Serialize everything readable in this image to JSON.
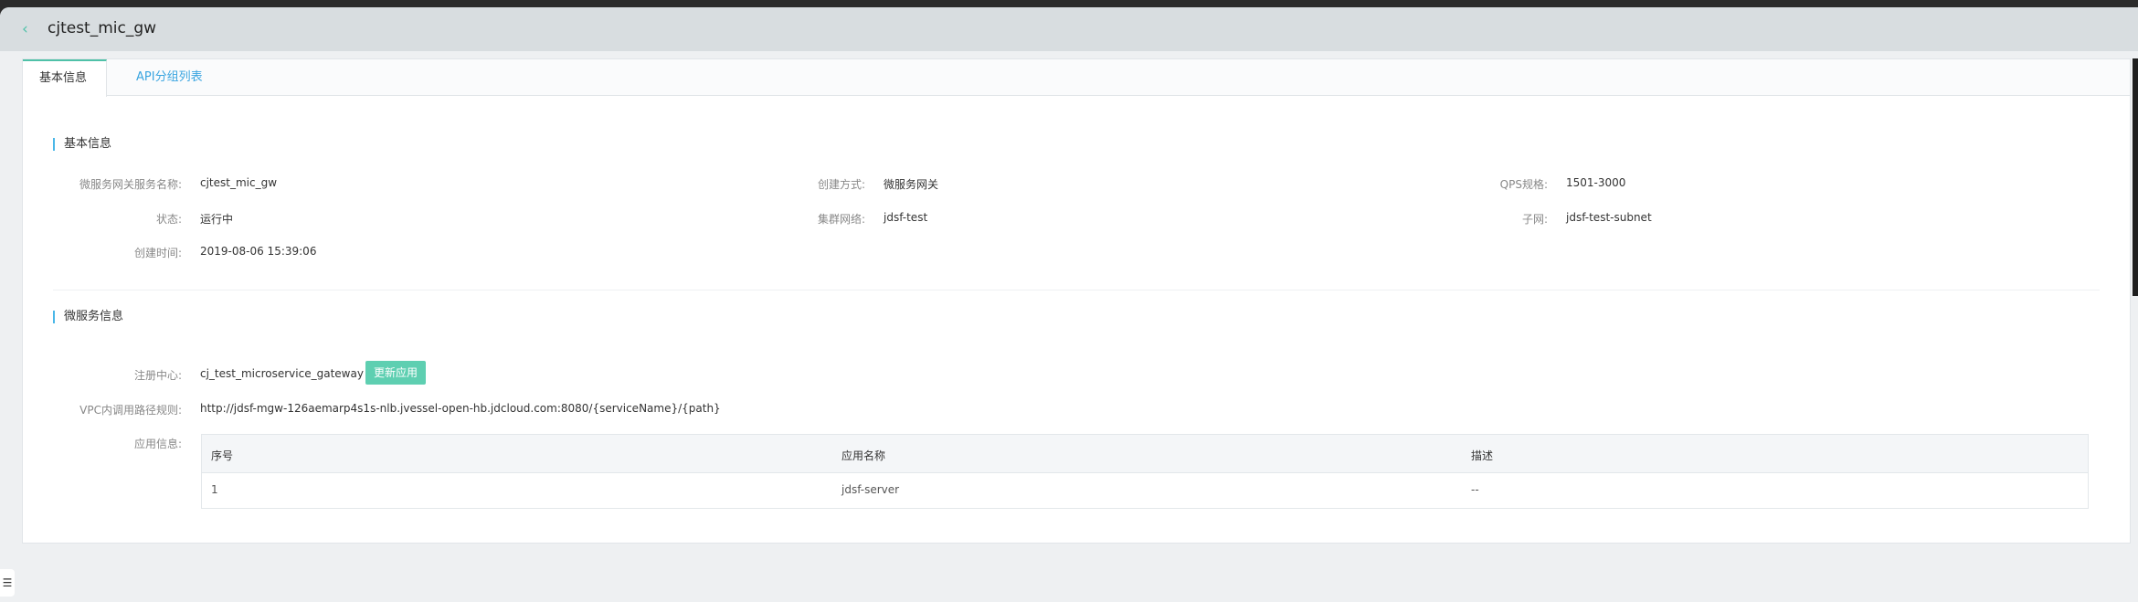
{
  "header": {
    "title": "cjtest_mic_gw"
  },
  "tabs": [
    {
      "label": "基本信息"
    },
    {
      "label": "API分组列表"
    }
  ],
  "basic_info": {
    "section_title": "基本信息",
    "fields": {
      "service_name": {
        "label": "微服务网关服务名称:",
        "value": "cjtest_mic_gw"
      },
      "create_method": {
        "label": "创建方式:",
        "value": "微服务网关"
      },
      "qps": {
        "label": "QPS规格:",
        "value": "1501-3000"
      },
      "status": {
        "label": "状态:",
        "value": "运行中"
      },
      "cluster_network": {
        "label": "集群网络:",
        "value": "jdsf-test"
      },
      "subnet": {
        "label": "子网:",
        "value": "jdsf-test-subnet"
      },
      "created_time": {
        "label": "创建时间:",
        "value": "2019-08-06 15:39:06"
      }
    }
  },
  "microservice_info": {
    "section_title": "微服务信息",
    "registry": {
      "label": "注册中心:",
      "value": "cj_test_microservice_gateway",
      "button": "更新应用"
    },
    "vpc_rule": {
      "label": "VPC内调用路径规则:",
      "value": "http://jdsf-mgw-126aemarp4s1s-nlb.jvessel-open-hb.jdcloud.com:8080/{serviceName}/{path}"
    },
    "app_info": {
      "label": "应用信息:",
      "columns": [
        "序号",
        "应用名称",
        "描述"
      ],
      "rows": [
        {
          "index": "1",
          "name": "jdsf-server",
          "desc": "--"
        }
      ]
    }
  },
  "colors": {
    "accent": "#4fc1a8",
    "link": "#3aa5e0",
    "section_bar": "#4ab7e8"
  },
  "icons": {
    "back": "chevron-left-icon",
    "float": "list-icon"
  }
}
